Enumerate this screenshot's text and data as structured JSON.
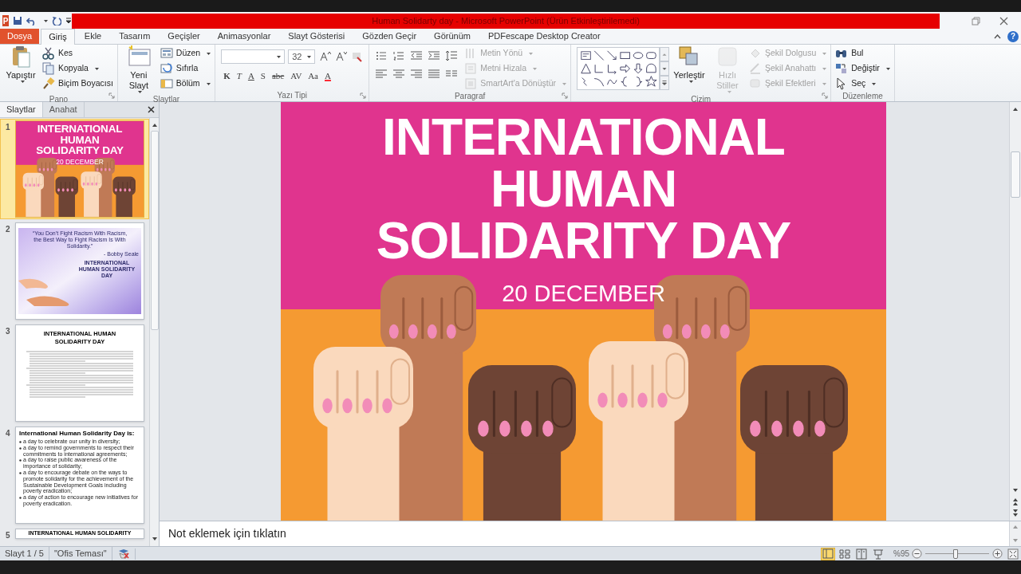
{
  "window": {
    "logo_letter": "P",
    "title": "Human Solidarty day  -  Microsoft PowerPoint (Ürün Etkinleştirilemedi)",
    "help_label": "?"
  },
  "tabs": [
    {
      "label": "Dosya",
      "kind": "file",
      "selected": false
    },
    {
      "label": "Giriş",
      "kind": "tab",
      "selected": true
    },
    {
      "label": "Ekle",
      "kind": "tab",
      "selected": false
    },
    {
      "label": "Tasarım",
      "kind": "tab",
      "selected": false
    },
    {
      "label": "Geçişler",
      "kind": "tab",
      "selected": false
    },
    {
      "label": "Animasyonlar",
      "kind": "tab",
      "selected": false
    },
    {
      "label": "Slayt Gösterisi",
      "kind": "tab",
      "selected": false
    },
    {
      "label": "Gözden Geçir",
      "kind": "tab",
      "selected": false
    },
    {
      "label": "Görünüm",
      "kind": "tab",
      "selected": false
    },
    {
      "label": "PDFescape Desktop Creator",
      "kind": "tab",
      "selected": false
    }
  ],
  "ribbon": [
    {
      "label": "Pano",
      "kind": "buttons",
      "launcher": true,
      "items": [
        {
          "kind": "large",
          "label": "Yapıştır",
          "disabled": false,
          "dropdown": true
        },
        {
          "kind": "small",
          "label": "Kes",
          "disabled": false,
          "dropdown": false
        },
        {
          "kind": "small",
          "label": "Kopyala",
          "disabled": false,
          "dropdown": true
        },
        {
          "kind": "small",
          "label": "Biçim Boyacısı",
          "disabled": false,
          "dropdown": false
        }
      ]
    },
    {
      "label": "Slaytlar",
      "kind": "buttons",
      "launcher": false,
      "items": [
        {
          "kind": "large",
          "label": "Yeni Slayt",
          "disabled": false,
          "dropdown": true
        },
        {
          "kind": "small",
          "label": "Düzen",
          "disabled": false,
          "dropdown": true
        },
        {
          "kind": "small",
          "label": "Sıfırla",
          "disabled": false,
          "dropdown": false
        },
        {
          "kind": "small",
          "label": "Bölüm",
          "disabled": false,
          "dropdown": true
        }
      ]
    },
    {
      "label": "Yazı Tipi",
      "kind": "font",
      "launcher": true,
      "font_size": "32",
      "format_buttons": [
        "K",
        "T",
        "A",
        "S",
        "abc",
        "AV",
        "Aa",
        "A"
      ]
    },
    {
      "label": "Paragraf",
      "kind": "paragraph",
      "launcher": true,
      "items": [
        {
          "kind": "small",
          "label": "Metin Yönü",
          "disabled": true,
          "dropdown": true
        },
        {
          "kind": "small",
          "label": "Metni Hizala",
          "disabled": true,
          "dropdown": true
        },
        {
          "kind": "small",
          "label": "SmartArt'a Dönüştür",
          "disabled": true,
          "dropdown": true
        }
      ]
    },
    {
      "label": "Çizim",
      "kind": "drawing",
      "launcher": true,
      "items": [
        {
          "kind": "large",
          "label": "Yerleştir",
          "disabled": false,
          "dropdown": true
        },
        {
          "kind": "large",
          "label": "Hızlı Stiller",
          "disabled": true,
          "dropdown": true
        },
        {
          "kind": "small",
          "label": "Şekil Dolgusu",
          "disabled": true,
          "dropdown": true
        },
        {
          "kind": "small",
          "label": "Şekil Anahattı",
          "disabled": true,
          "dropdown": true
        },
        {
          "kind": "small",
          "label": "Şekil Efektleri",
          "disabled": true,
          "dropdown": true
        }
      ]
    },
    {
      "label": "Düzenleme",
      "kind": "buttons",
      "launcher": false,
      "items": [
        {
          "kind": "small",
          "label": "Bul",
          "disabled": false,
          "dropdown": false
        },
        {
          "kind": "small",
          "label": "Değiştir",
          "disabled": false,
          "dropdown": true
        },
        {
          "kind": "small",
          "label": "Seç",
          "disabled": false,
          "dropdown": true
        }
      ]
    }
  ],
  "slide_panel": {
    "tabs": [
      {
        "label": "Slaytlar",
        "selected": true
      },
      {
        "label": "Anahat",
        "selected": false
      }
    ],
    "slides": [
      {
        "number": "1",
        "selected": true,
        "kind": "title",
        "title_lines": [
          "INTERNATIONAL",
          "HUMAN",
          "SOLIDARITY DAY"
        ],
        "date": "20 DECEMBER"
      },
      {
        "number": "2",
        "selected": false,
        "kind": "quote",
        "quote_lines": [
          "“You Don’t Fight Racism With Racism,",
          "the Best Way to Fight Racism Is With Solidarity.”"
        ],
        "author": "- Bobby Seale",
        "caption": "INTERNATIONAL HUMAN SOLIDARITY DAY"
      },
      {
        "number": "3",
        "selected": false,
        "kind": "text",
        "title": "INTERNATIONAL HUMAN SOLIDARITY DAY"
      },
      {
        "number": "4",
        "selected": false,
        "kind": "bullets",
        "title": "International Human Solidarity Day is:",
        "bullets": [
          "a day to celebrate our unity in diversity;",
          "a day to remind governments to respect their commitments to international agreements;",
          "a day to raise public awareness of the importance of solidarity;",
          "a day to encourage debate on the ways to promote solidarity for the achievement of the Sustainable Development Goals including poverty eradication;",
          "a day of action to encourage new initiatives for poverty eradication."
        ]
      },
      {
        "number": "5",
        "selected": false,
        "kind": "heading",
        "title": "INTERNATIONAL HUMAN SOLIDARITY"
      }
    ]
  },
  "main_slide": {
    "title_lines": [
      "INTERNATIONAL",
      "HUMAN",
      "SOLIDARITY DAY"
    ],
    "date": "20 DECEMBER"
  },
  "notes": {
    "text": "Not eklemek için tıklatın"
  },
  "status_bar": {
    "slide_info": "Slayt 1 / 5",
    "theme": "\"Ofis Teması\"",
    "views": [
      {
        "selected": true
      },
      {
        "selected": false
      },
      {
        "selected": false
      },
      {
        "selected": false
      }
    ],
    "zoom": "%95",
    "zoom_slider": {
      "level": 0.47
    }
  }
}
